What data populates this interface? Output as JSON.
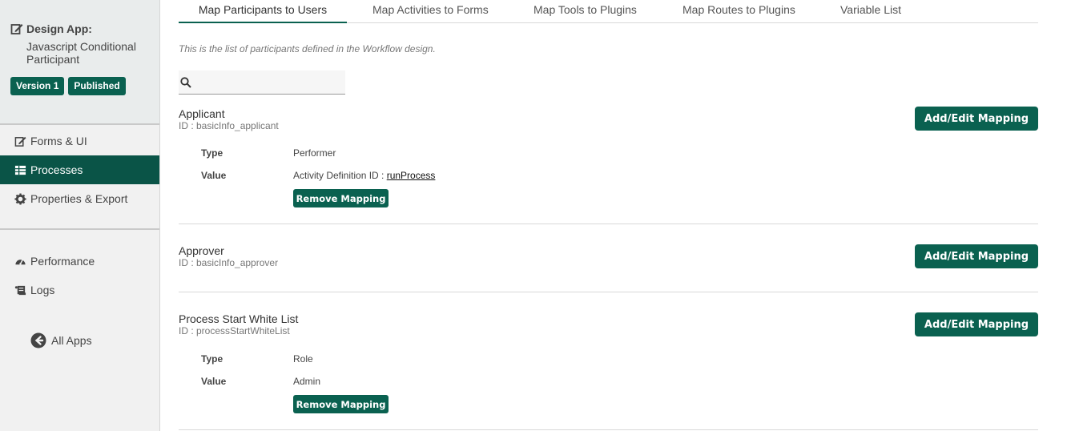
{
  "sidebar": {
    "app_title": "Design App:",
    "app_name": "Javascript Conditional Participant",
    "badges": [
      "Version 1",
      "Published"
    ],
    "nav": [
      {
        "label": "Forms & UI",
        "icon": "edit-icon"
      },
      {
        "label": "Processes",
        "icon": "table-icon",
        "active": true
      },
      {
        "label": "Properties & Export",
        "icon": "gear-icon"
      },
      {
        "label": "Performance",
        "icon": "gauge-icon"
      },
      {
        "label": "Logs",
        "icon": "scroll-icon"
      }
    ],
    "all_apps": "All Apps"
  },
  "tabs": [
    "Map Participants to Users",
    "Map Activities to Forms",
    "Map Tools to Plugins",
    "Map Routes to Plugins",
    "Variable List"
  ],
  "intro": "This is the list of participants defined in the Workflow design.",
  "search": {
    "value": ""
  },
  "participants": [
    {
      "name": "Applicant",
      "id": "ID : basicInfo_applicant",
      "type_label": "Type",
      "type": "Performer",
      "value_label": "Value",
      "value_prefix": "Activity Definition ID : ",
      "value_link": "runProcess",
      "remove_label": "Remove Mapping",
      "action_label": "Add/Edit Mapping"
    },
    {
      "name": "Approver",
      "id": "ID : basicInfo_approver",
      "action_label": "Add/Edit Mapping"
    },
    {
      "name": "Process Start White List",
      "id": "ID : processStartWhiteList",
      "type_label": "Type",
      "type": "Role",
      "value_label": "Value",
      "value_prefix": "Admin",
      "remove_label": "Remove Mapping",
      "action_label": "Add/Edit Mapping"
    }
  ],
  "colors": {
    "accent": "#0a6150",
    "active_nav": "#0a5447"
  }
}
